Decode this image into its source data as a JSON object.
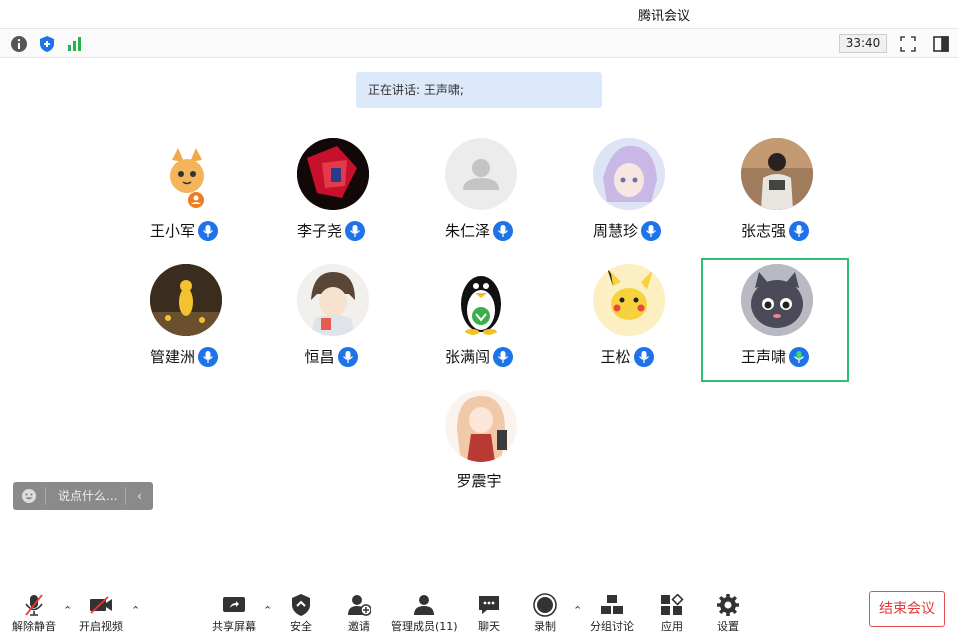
{
  "window": {
    "title": "腾讯会议"
  },
  "infobar": {
    "timer": "33:40"
  },
  "speaking": {
    "text": "正在讲话: 王声啸;"
  },
  "participants": [
    {
      "name": "王小军",
      "avatar": "cat-cartoon-avatar"
    },
    {
      "name": "李子尧",
      "avatar": "red-robot-avatar"
    },
    {
      "name": "朱仁泽",
      "avatar": "default-person-avatar"
    },
    {
      "name": "周慧珍",
      "avatar": "anime-girl-avatar"
    },
    {
      "name": "张志强",
      "avatar": "photo-person-avatar"
    },
    {
      "name": "管建洲",
      "avatar": "yellow-figure-avatar"
    },
    {
      "name": "恒昌",
      "avatar": "anime-boy-avatar"
    },
    {
      "name": "张满闯",
      "avatar": "penguin-avatar"
    },
    {
      "name": "王松",
      "avatar": "pikachu-avatar"
    },
    {
      "name": "王声啸",
      "avatar": "dark-cat-avatar"
    },
    {
      "name": "罗震宇",
      "avatar": "anime-doll-avatar"
    }
  ],
  "chat": {
    "placeholder": "说点什么...",
    "collapse": "‹"
  },
  "toolbar": {
    "unmute": "解除静音",
    "start_video": "开启视频",
    "share_screen": "共享屏幕",
    "security": "安全",
    "invite": "邀请",
    "manage_members": "管理成员(11)",
    "chat": "聊天",
    "record": "录制",
    "breakout": "分组讨论",
    "apps": "应用",
    "settings": "设置",
    "end_meeting": "结束会议"
  },
  "colors": {
    "accent": "#1e73e8",
    "active_border": "#2fbf71",
    "end_red": "#e03b3b",
    "speaking_bg": "#dbe9fb"
  }
}
